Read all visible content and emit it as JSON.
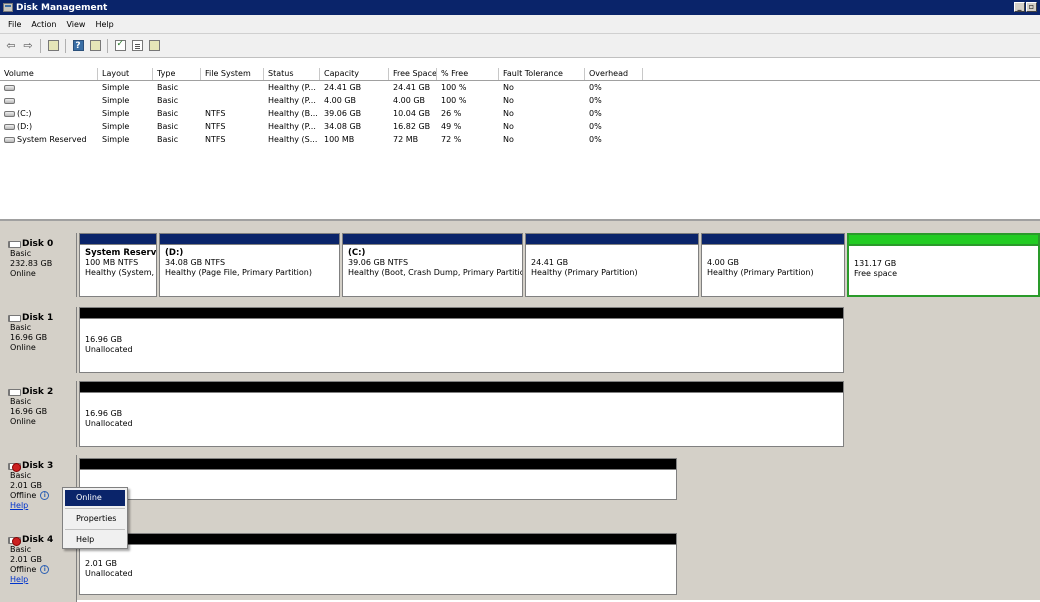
{
  "window": {
    "title": "Disk Management"
  },
  "menu": [
    "File",
    "Action",
    "View",
    "Help"
  ],
  "toolbar": {
    "icons": [
      "back-arrow-icon",
      "forward-arrow-icon",
      "show-hide-tree-icon",
      "help-icon",
      "console-icon",
      "refresh-icon",
      "properties-icon",
      "rescan-icon"
    ]
  },
  "volume_list": {
    "columns": [
      "Volume",
      "Layout",
      "Type",
      "File System",
      "Status",
      "Capacity",
      "Free Space",
      "% Free",
      "Fault Tolerance",
      "Overhead"
    ],
    "rows": [
      [
        "",
        "Simple",
        "Basic",
        "",
        "Healthy (P...",
        "24.41 GB",
        "24.41 GB",
        "100 %",
        "No",
        "0%"
      ],
      [
        "",
        "Simple",
        "Basic",
        "",
        "Healthy (P...",
        "4.00 GB",
        "4.00 GB",
        "100 %",
        "No",
        "0%"
      ],
      [
        "(C:)",
        "Simple",
        "Basic",
        "NTFS",
        "Healthy (B...",
        "39.06 GB",
        "10.04 GB",
        "26 %",
        "No",
        "0%"
      ],
      [
        "(D:)",
        "Simple",
        "Basic",
        "NTFS",
        "Healthy (P...",
        "34.08 GB",
        "16.82 GB",
        "49 %",
        "No",
        "0%"
      ],
      [
        "System Reserved",
        "Simple",
        "Basic",
        "NTFS",
        "Healthy (S...",
        "100 MB",
        "72 MB",
        "72 %",
        "No",
        "0%"
      ]
    ]
  },
  "disks": [
    {
      "name": "Disk 0",
      "type": "Basic",
      "size": "232.83 GB",
      "status": "Online",
      "partitions": [
        {
          "name": "System Reserve",
          "size": "100 MB NTFS",
          "status": "Healthy (System, A"
        },
        {
          "name": "(D:)",
          "size": "34.08 GB NTFS",
          "status": "Healthy (Page File, Primary Partition)"
        },
        {
          "name": "(C:)",
          "size": "39.06 GB NTFS",
          "status": "Healthy (Boot, Crash Dump, Primary Partition)"
        },
        {
          "name": "",
          "size": "24.41 GB",
          "status": "Healthy (Primary Partition)"
        },
        {
          "name": "",
          "size": "4.00 GB",
          "status": "Healthy (Primary Partition)"
        },
        {
          "name": "",
          "size": "131.17 GB",
          "status": "Free space"
        }
      ]
    },
    {
      "name": "Disk 1",
      "type": "Basic",
      "size": "16.96 GB",
      "status": "Online",
      "partitions": [
        {
          "size": "16.96 GB",
          "status": "Unallocated"
        }
      ]
    },
    {
      "name": "Disk 2",
      "type": "Basic",
      "size": "16.96 GB",
      "status": "Online",
      "partitions": [
        {
          "size": "16.96 GB",
          "status": "Unallocated"
        }
      ]
    },
    {
      "name": "Disk 3",
      "type": "Basic",
      "size": "2.01 GB",
      "status": "Offline",
      "help": "Help",
      "partitions": [
        {
          "size": "",
          "status": ""
        }
      ]
    },
    {
      "name": "Disk 4",
      "type": "Basic",
      "size": "2.01 GB",
      "status": "Offline",
      "help": "Help",
      "partitions": [
        {
          "size": "2.01 GB",
          "status": "Unallocated"
        }
      ]
    }
  ],
  "context_menu": {
    "items": [
      "Online",
      "Properties",
      "Help"
    ]
  },
  "colors": {
    "primary_partition": "#0a246a",
    "unallocated": "#000000",
    "free_space": "#22cc22",
    "title_bar": "#0a246a"
  }
}
